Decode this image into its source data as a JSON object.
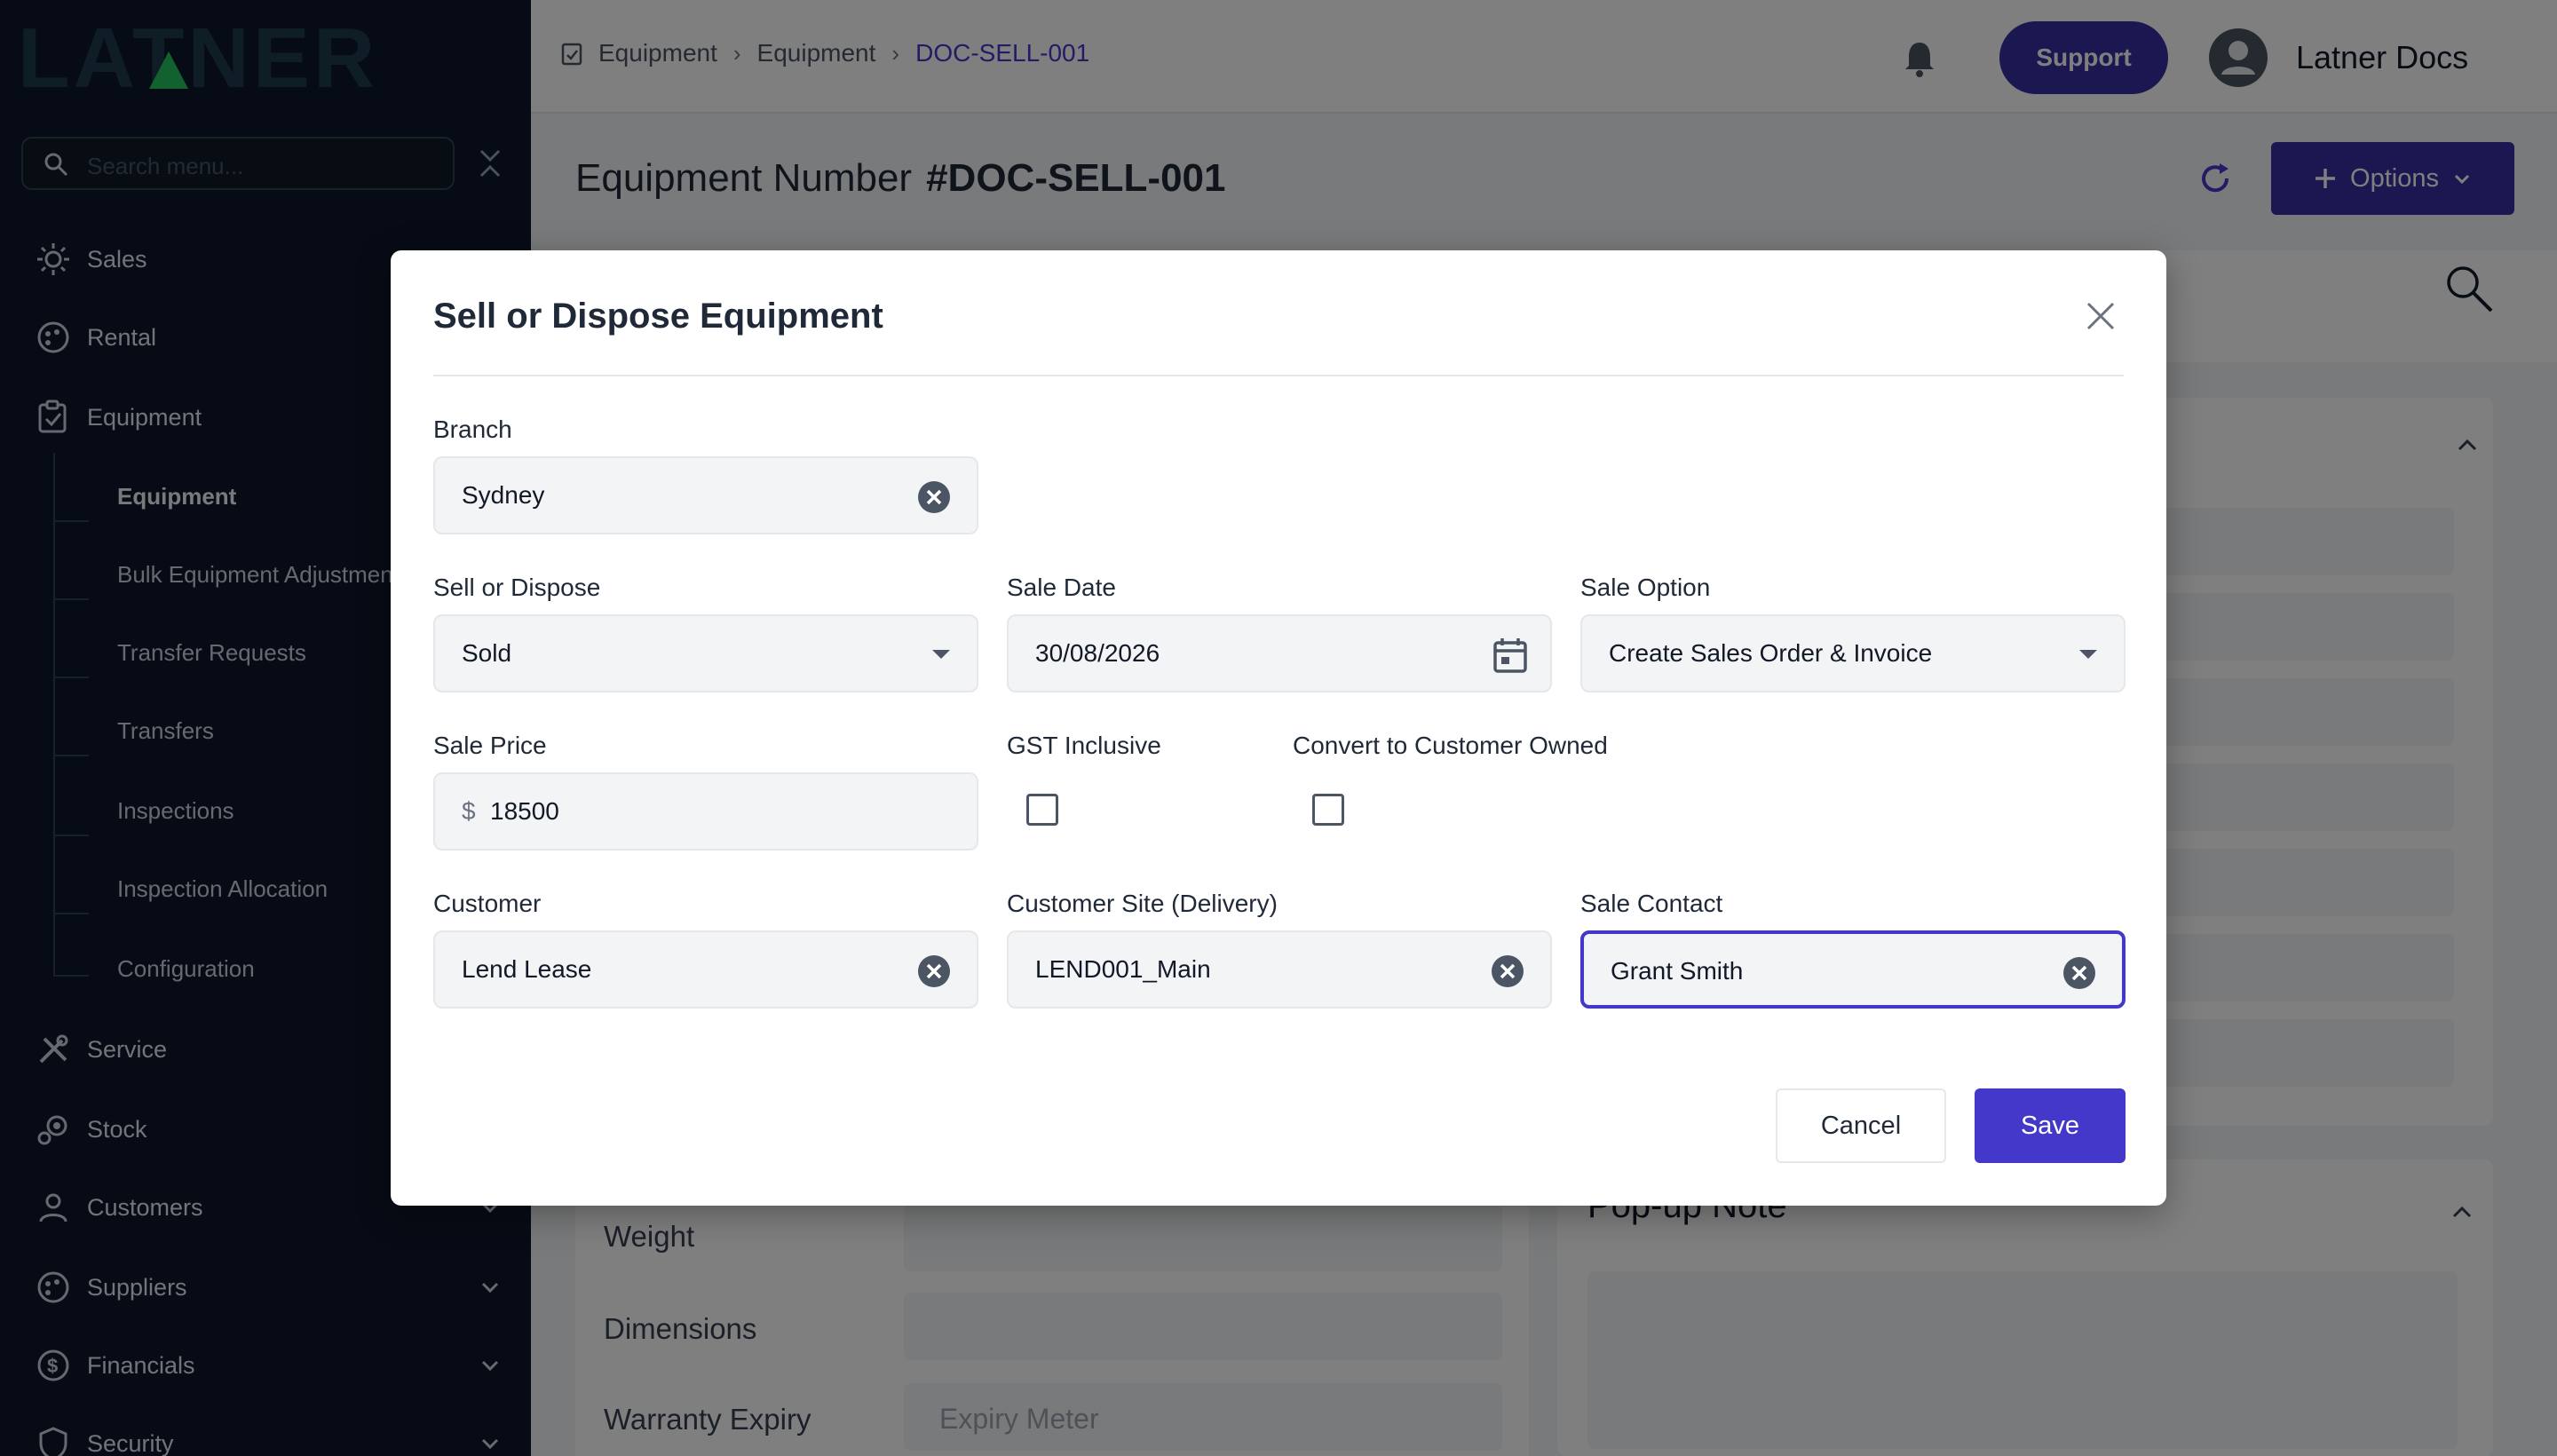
{
  "app": {
    "logo_text": "LATNER"
  },
  "sidebar": {
    "search_placeholder": "Search menu...",
    "items": [
      {
        "label": "Sales",
        "icon": "sales-icon"
      },
      {
        "label": "Rental",
        "icon": "rental-icon"
      },
      {
        "label": "Equipment",
        "icon": "equipment-icon"
      },
      {
        "label": "Service",
        "icon": "service-icon"
      },
      {
        "label": "Stock",
        "icon": "stock-icon"
      },
      {
        "label": "Customers",
        "icon": "customers-icon"
      },
      {
        "label": "Suppliers",
        "icon": "suppliers-icon"
      },
      {
        "label": "Financials",
        "icon": "financials-icon"
      },
      {
        "label": "Security",
        "icon": "security-icon"
      }
    ],
    "equipment_sub": [
      "Equipment",
      "Bulk Equipment Adjustment",
      "Transfer Requests",
      "Transfers",
      "Inspections",
      "Inspection Allocation",
      "Configuration"
    ]
  },
  "header": {
    "breadcrumb": [
      "Equipment",
      "Equipment",
      "DOC-SELL-001"
    ],
    "support_label": "Support",
    "user_name": "Latner Docs"
  },
  "page": {
    "title_label": "Equipment Number",
    "title_value": "#DOC-SELL-001",
    "options_label": "Options",
    "fields": {
      "weight": "Weight",
      "dimensions": "Dimensions",
      "warranty_expiry": "Warranty Expiry",
      "expiry_meter_placeholder": "Expiry Meter"
    },
    "popup_note_title": "Pop-up Note"
  },
  "modal": {
    "title": "Sell or Dispose Equipment",
    "branch": {
      "label": "Branch",
      "value": "Sydney"
    },
    "sell_or_dispose": {
      "label": "Sell or Dispose",
      "value": "Sold"
    },
    "sale_date": {
      "label": "Sale Date",
      "value": "30/08/2026"
    },
    "sale_option": {
      "label": "Sale Option",
      "value": "Create Sales Order & Invoice"
    },
    "sale_price": {
      "label": "Sale Price",
      "currency": "$",
      "value": "18500"
    },
    "gst_inclusive": {
      "label": "GST Inclusive",
      "checked": false
    },
    "convert_owned": {
      "label": "Convert to Customer Owned",
      "checked": false
    },
    "customer": {
      "label": "Customer",
      "value": "Lend Lease"
    },
    "customer_site": {
      "label": "Customer Site (Delivery)",
      "value": "LEND001_Main"
    },
    "sale_contact": {
      "label": "Sale Contact",
      "value": "Grant Smith"
    },
    "cancel_label": "Cancel",
    "save_label": "Save"
  },
  "colors": {
    "sidebar_bg": "#0f172a",
    "accent": "#4338ca",
    "support_bg": "#3730a3",
    "logo_green": "#22c55e"
  }
}
